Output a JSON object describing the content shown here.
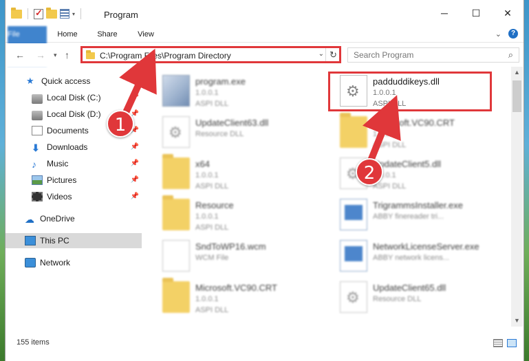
{
  "window": {
    "title": "Program",
    "controls": {
      "minimize": "─",
      "maximize": "☐",
      "close": "✕"
    }
  },
  "ribbon": {
    "tabs": [
      {
        "label": "File"
      },
      {
        "label": "Home"
      },
      {
        "label": "Share"
      },
      {
        "label": "View"
      }
    ],
    "help": "?"
  },
  "navbar": {
    "address": "C:\\Program Files\\Program Directory",
    "search_placeholder": "Search Program"
  },
  "sidebar": {
    "items": [
      {
        "label": "Quick access",
        "icon": "star-icon"
      },
      {
        "label": "Local Disk (C:)",
        "icon": "disk-icon"
      },
      {
        "label": "Local Disk (D:)",
        "icon": "disk-icon"
      },
      {
        "label": "Documents",
        "icon": "documents-icon"
      },
      {
        "label": "Downloads",
        "icon": "download-icon"
      },
      {
        "label": "Music",
        "icon": "music-icon"
      },
      {
        "label": "Pictures",
        "icon": "pictures-icon"
      },
      {
        "label": "Videos",
        "icon": "videos-icon"
      },
      {
        "label": "OneDrive",
        "icon": "cloud-icon"
      },
      {
        "label": "This PC",
        "icon": "pc-icon"
      },
      {
        "label": "Network",
        "icon": "network-icon"
      }
    ],
    "selected": "This PC"
  },
  "files": [
    {
      "name": "program.exe",
      "line2": "1.0.0.1",
      "line3": "ASPI DLL",
      "icon": "exe"
    },
    {
      "name": "padduddikeys.dll",
      "line2": "1.0.0.1",
      "line3": "ASPI DLL",
      "icon": "dll"
    },
    {
      "name": "UpdateClient63.dll",
      "line2": "Resource DLL",
      "line3": "",
      "icon": "dll"
    },
    {
      "name": "Microsoft.VC90.CRT",
      "line2": "1.0.0.1",
      "line3": "ASPI DLL",
      "icon": "folder"
    },
    {
      "name": "x64",
      "line2": "1.0.0.1",
      "line3": "ASPI DLL",
      "icon": "folder"
    },
    {
      "name": "UpdateClient5.dll",
      "line2": "1.0.0.1",
      "line3": "ASPI DLL",
      "icon": "dll"
    },
    {
      "name": "Resource",
      "line2": "1.0.0.1",
      "line3": "ASPI DLL",
      "icon": "folder"
    },
    {
      "name": "TrigrammsInstaller.exe",
      "line2": "ABBY finereader tri...",
      "line3": "",
      "icon": "app"
    },
    {
      "name": "SndToWP16.wcm",
      "line2": "WCM File",
      "line3": "",
      "icon": "blank"
    },
    {
      "name": "NetworkLicenseServer.exe",
      "line2": "ABBY network licens...",
      "line3": "",
      "icon": "app"
    },
    {
      "name": "Microsoft.VC90.CRT",
      "line2": "1.0.0.1",
      "line3": "ASPI DLL",
      "icon": "folder"
    },
    {
      "name": "UpdateClient65.dll",
      "line2": "Resource DLL",
      "line3": "",
      "icon": "dll"
    }
  ],
  "status": {
    "count": "155 items"
  },
  "annotations": {
    "badge1": "1",
    "badge2": "2",
    "color": "#e0373a"
  }
}
